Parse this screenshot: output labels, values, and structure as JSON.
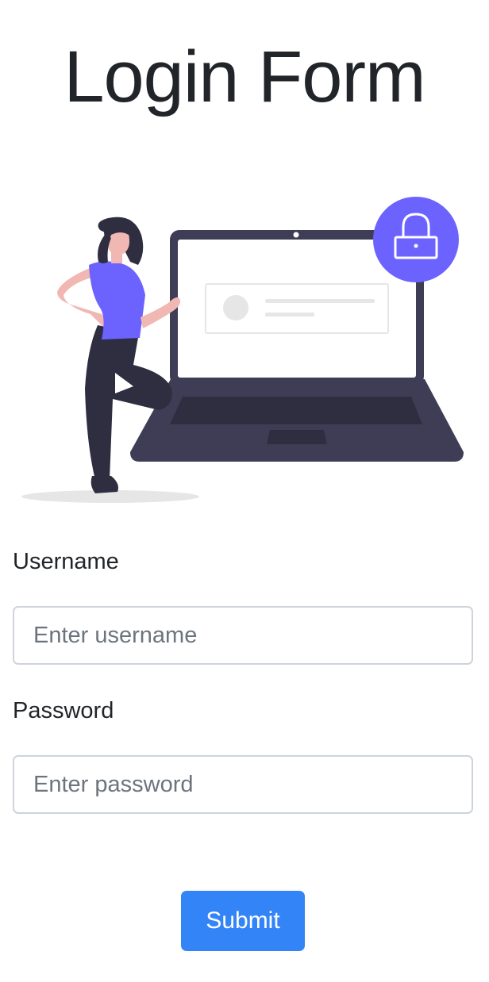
{
  "page": {
    "title": "Login Form"
  },
  "illustration": {
    "subject": "person-leaning-on-laptop-with-lock",
    "colors": {
      "accent": "#6c63ff",
      "dark": "#3f3d56",
      "skin": "#f1b7b3",
      "hair": "#2f2e41",
      "shadow": "#e6e6e6"
    }
  },
  "form": {
    "username": {
      "label": "Username",
      "value": "",
      "placeholder": "Enter username"
    },
    "password": {
      "label": "Password",
      "value": "",
      "placeholder": "Enter password"
    },
    "submit_label": "Submit"
  },
  "colors": {
    "primary_button": "#3385f7",
    "input_border": "#ced4da",
    "text": "#212529",
    "placeholder": "#6c757d"
  }
}
